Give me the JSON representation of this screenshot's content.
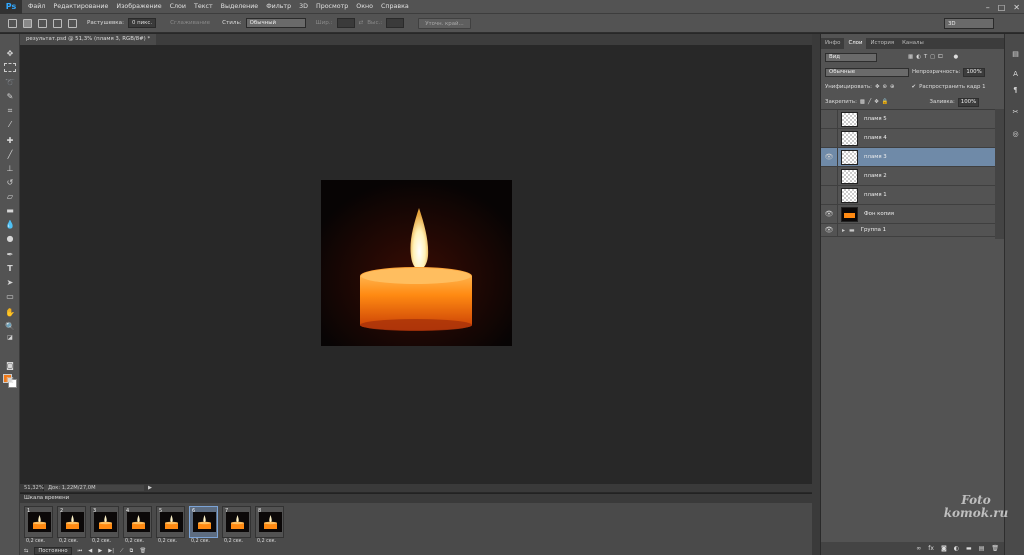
{
  "menu": {
    "logo": "Ps",
    "items": [
      "Файл",
      "Редактирование",
      "Изображение",
      "Слои",
      "Текст",
      "Выделение",
      "Фильтр",
      "3D",
      "Просмотр",
      "Окно",
      "Справка"
    ],
    "window_controls": [
      "–",
      "□",
      "✕"
    ]
  },
  "options": {
    "feather_label": "Растушевка:",
    "feather_value": "0 пикс.",
    "antialias_label": "Сглаживание",
    "style_label": "Стиль:",
    "style_value": "Обычный",
    "width_label": "Шир.:",
    "height_label": "Выс.:",
    "refine_button": "Уточн. край...",
    "workspace": "3D"
  },
  "document": {
    "tab_title": "результат.psd @ 51,3% (пламя 3, RGB/8#) *",
    "zoom": "51,32%",
    "doc_info": "Док: 1,22М/27,0М"
  },
  "timeline": {
    "title": "Шкала времени",
    "frames": [
      {
        "num": "1",
        "time": "0,2 сек.",
        "selected": false
      },
      {
        "num": "2",
        "time": "0,2 сек.",
        "selected": false
      },
      {
        "num": "3",
        "time": "0,2 сек.",
        "selected": false
      },
      {
        "num": "4",
        "time": "0,2 сек.",
        "selected": false
      },
      {
        "num": "5",
        "time": "0,2 сек.",
        "selected": false
      },
      {
        "num": "6",
        "time": "0,2 сек.",
        "selected": true
      },
      {
        "num": "7",
        "time": "0,2 сек.",
        "selected": false
      },
      {
        "num": "8",
        "time": "0,2 сек.",
        "selected": false
      }
    ],
    "loop": "Постоянно",
    "controls": [
      "⏮",
      "◀",
      "▶",
      "▶|"
    ]
  },
  "panels": {
    "tabs": [
      "Инфо",
      "Слои",
      "История",
      "Каналы"
    ],
    "active_tab": "Слои",
    "kind_filter": "Вид",
    "blend_mode": "Обычные",
    "opacity_label": "Непрозрачность:",
    "opacity_value": "100%",
    "unify_label": "Унифицировать:",
    "propagate_label": "Распространить кадр 1",
    "lock_label": "Закрепить:",
    "fill_label": "Заливка:",
    "fill_value": "100%",
    "layers": [
      {
        "name": "пламя 5",
        "visible": false,
        "selected": false,
        "thumb": "transparent"
      },
      {
        "name": "пламя 4",
        "visible": false,
        "selected": false,
        "thumb": "transparent"
      },
      {
        "name": "пламя 3",
        "visible": true,
        "selected": true,
        "thumb": "transparent"
      },
      {
        "name": "пламя 2",
        "visible": false,
        "selected": false,
        "thumb": "transparent"
      },
      {
        "name": "пламя 1",
        "visible": false,
        "selected": false,
        "thumb": "transparent"
      },
      {
        "name": "Фон копия",
        "visible": true,
        "selected": false,
        "thumb": "candle"
      },
      {
        "name": "Группа 1",
        "visible": true,
        "selected": false,
        "thumb": "folder"
      }
    ]
  },
  "colors": {
    "foreground": "#ef7a1a",
    "background": "#ffffff",
    "selection": "#6f8aa8"
  },
  "watermark": {
    "line1": "Foto",
    "line2": "komok.ru"
  }
}
